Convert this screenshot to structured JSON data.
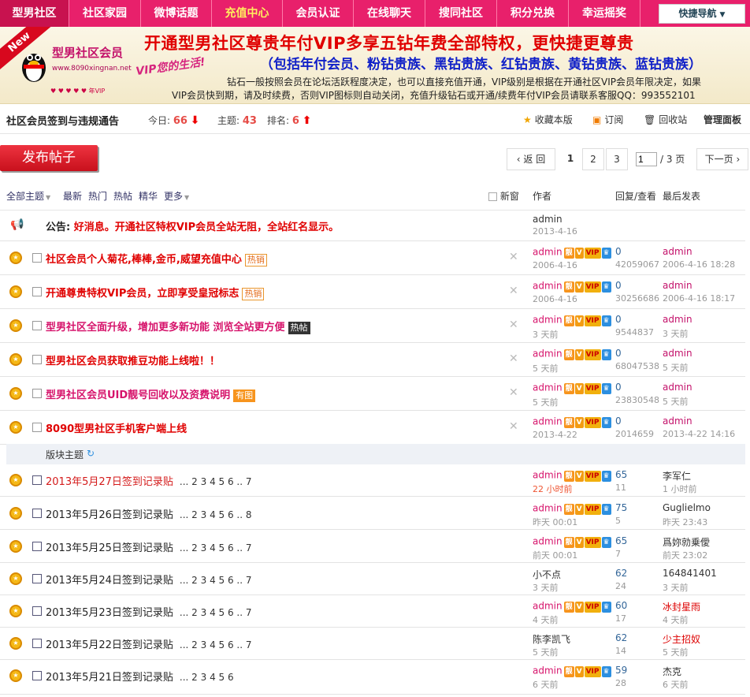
{
  "nav": {
    "items": [
      "型男社区",
      "社区家园",
      "微博话题",
      "充值中心",
      "会员认证",
      "在线聊天",
      "搜同社区",
      "积分兑换",
      "幸运摇奖"
    ],
    "quick": "快捷导航"
  },
  "banner": {
    "new_tag": "New",
    "logo_title": "型男社区会员",
    "logo_url": "www.8090xingnan.net",
    "slogan": "VIP您的生活!",
    "vip_icons": "♥ ♥ ♥ ♥ ♥ 年VIP",
    "line1": "开通型男社区尊贵年付VIP多享五钻年费全部特权，更快捷更尊贵",
    "line2": "（包括年付会员、粉钻贵族、黑钻贵族、红钻贵族、黄钻贵族、蓝钻贵族）",
    "line3": "钻石一般按照会员在论坛活跃程度决定，也可以直接充值开通，VIP级别是根据在开通社区VIP会员年限决定，如果",
    "line4": "VIP会员快到期，请及时续费，否则VIP图标则自动关闭，充值升级钻石或开通/续费年付VIP会员请联系客服QQ：993552101"
  },
  "forum": {
    "title": "社区会员签到与违规通告",
    "today_label": "今日:",
    "today": "66",
    "topics_label": "主题:",
    "topics": "43",
    "rank_label": "排名:",
    "rank": "6",
    "fav": "收藏本版",
    "subscribe": "订阅",
    "recycle": "回收站",
    "admin": "管理面板"
  },
  "toolbar": {
    "post": "发布帖子",
    "prev": "返 回",
    "pages": [
      "1",
      "2",
      "3"
    ],
    "page_input": "1",
    "page_total": "/ 3 页",
    "next": "下一页"
  },
  "listhead": {
    "all": "全部主题",
    "filters": [
      "最新",
      "热门",
      "热帖",
      "精华",
      "更多"
    ],
    "newwin": "新窗",
    "author": "作者",
    "reply": "回复/查看",
    "last": "最后发表"
  },
  "announcement": {
    "label": "公告:",
    "text": "好消息。开通社区特权VIP会员全站无阻，全站红名显示。",
    "author": "admin",
    "date": "2013-4-16"
  },
  "sticky": [
    {
      "title": "社区会员个人菊花,棒棒,金币,威望充值中心",
      "tag": "热销",
      "author": "admin",
      "date": "2006-4-16",
      "replies": "0",
      "views": "42059067",
      "last": "admin",
      "last_date": "2006-4-16 18:28"
    },
    {
      "title": "开通尊贵特权VIP会员，立即享受皇冠标志",
      "tag": "热销",
      "author": "admin",
      "date": "2006-4-16",
      "replies": "0",
      "views": "30256686",
      "last": "admin",
      "last_date": "2006-4-16 18:17"
    },
    {
      "title": "型男社区全面升级，增加更多新功能 浏览全站更方便",
      "tag": "热帖",
      "author": "admin",
      "date": "3 天前",
      "replies": "0",
      "views": "9544837",
      "last": "admin",
      "last_date": "3 天前"
    },
    {
      "title": "型男社区会员获取推豆功能上线啦！！",
      "tag": "",
      "author": "admin",
      "date": "5 天前",
      "replies": "0",
      "views": "68047538",
      "last": "admin",
      "last_date": "5 天前"
    },
    {
      "title": "型男社区会员UID靓号回收以及资费说明",
      "tag": "有图",
      "author": "admin",
      "date": "5 天前",
      "replies": "0",
      "views": "23830548",
      "last": "admin",
      "last_date": "5 天前"
    },
    {
      "title": "8090型男社区手机客户端上线",
      "tag": "",
      "author": "admin",
      "date": "2013-4-22",
      "replies": "0",
      "views": "2014659",
      "last": "admin",
      "last_date": "2013-4-22 14:16"
    }
  ],
  "section_label": "版块主题",
  "section_refresh": "↻",
  "topics": [
    {
      "title": "2013年5月27日签到记录贴",
      "pages": "... 2 3 4 5 6 .. 7",
      "author": "admin",
      "date": "22 小时前",
      "replies": "65",
      "views": "11",
      "last": "李军仁",
      "last_date": "1 小时前"
    },
    {
      "title": "2013年5月26日签到记录贴",
      "pages": "... 2 3 4 5 6 .. 8",
      "author": "admin",
      "date": "昨天 00:01",
      "replies": "75",
      "views": "5",
      "last": "Guglielmo",
      "last_date": "昨天 23:43"
    },
    {
      "title": "2013年5月25日签到记录贴",
      "pages": "... 2 3 4 5 6 .. 7",
      "author": "admin",
      "date": "前天 00:01",
      "replies": "65",
      "views": "7",
      "last": "爲妳勍乗僾",
      "last_date": "前天 23:02"
    },
    {
      "title": "2013年5月24日签到记录贴",
      "pages": "... 2 3 4 5 6 .. 7",
      "author": "小不点",
      "date": "3 天前",
      "replies": "62",
      "views": "24",
      "last": "164841401",
      "last_date": "3 天前"
    },
    {
      "title": "2013年5月23日签到记录贴",
      "pages": "... 2 3 4 5 6 .. 7",
      "author": "admin",
      "date": "4 天前",
      "replies": "60",
      "views": "17",
      "last": "冰封星雨",
      "last_date": "4 天前"
    },
    {
      "title": "2013年5月22日签到记录贴",
      "pages": "... 2 3 4 5 6 .. 7",
      "author": "陈李凯飞",
      "date": "5 天前",
      "replies": "62",
      "views": "14",
      "last": "少主招奴",
      "last_date": "5 天前"
    },
    {
      "title": "2013年5月21日签到记录贴",
      "pages": "... 2 3 4 5 6",
      "author": "admin",
      "date": "6 天前",
      "replies": "59",
      "views": "28",
      "last": "杰克",
      "last_date": "6 天前"
    }
  ]
}
